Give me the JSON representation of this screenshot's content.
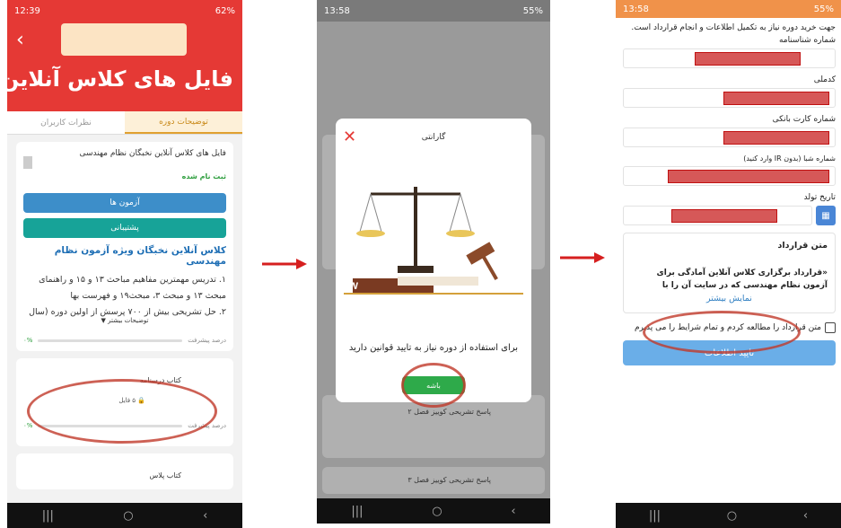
{
  "screen1": {
    "status": {
      "time": "12:39",
      "battery": "62%"
    },
    "banner_title": "فایل های کلاس آنلاین",
    "tabs": [
      "توضیحات دوره",
      "نظرات کاربران"
    ],
    "course_title": "فایل های کلاس آنلاین نخبگان نظام مهندسی",
    "registered": "ثبت نام شده",
    "btn_exams": "آزمون ها",
    "btn_support": "پشتیبانی",
    "heading": "کلاس آنلاین نخبگان ویژه آزمون نظام مهندسی",
    "line1": "۱. تدریس مهمترین مفاهیم مباحث ۱۳ و ۱۵ و راهنمای",
    "line2": "مبحث ۱۳ و مبحث ۳، مبحث۱۹ و فهرست بها",
    "line3": "۲. حل تشریحی بیش از ۷۰۰ پرسش از اولین دوره (سال",
    "more_desc": "توضیحات بیشتر",
    "progress_label": "درصد پیشرفت",
    "progress_value": "۰%",
    "item1_title": "کتاب درسنامه",
    "item1_files": "۵ فایل",
    "item2_title": "کتاب پلاس"
  },
  "screen2": {
    "status": {
      "time": "13:58",
      "battery": "55%"
    },
    "dialog_title": "گارانتی",
    "law_text": "LAW",
    "dialog_message": "برای استفاده از دوره نیاز به تایید قوانین دارید",
    "dialog_button": "باشه",
    "bg_item1": "پاسخ تشریحی کوییز فصل ۲",
    "bg_item2": "پاسخ تشریحی کوییز فصل ۳"
  },
  "screen3": {
    "status": {
      "time": "13:58",
      "battery": "55%"
    },
    "intro": "جهت خرید دوره نیاز به تکمیل اطلاعات و انجام قرارداد است.",
    "label_id": "شماره شناسنامه",
    "label_national": "کدملی",
    "label_card": "شماره کارت بانکی",
    "label_sheba": "شماره شبا (بدون IR وارد کنید)",
    "label_birth": "تاریخ تولد",
    "contract_title": "متن قرارداد",
    "contract_body": "«قرارداد برگزاری کلاس آنلاین آمادگی برای آزمون نظام مهندسی که در سایت آن را با گارانتی عودت وجه",
    "show_more": "نمایش بیشتر",
    "agree": "متن قرارداد را مطالعه کردم و تمام شرایط را می پذیرم",
    "submit": "تایید اطلاعات"
  },
  "colors": {
    "red": "#e53935",
    "arrow": "#d61f1f",
    "blue": "#3d8ec9",
    "teal": "#17a398"
  }
}
